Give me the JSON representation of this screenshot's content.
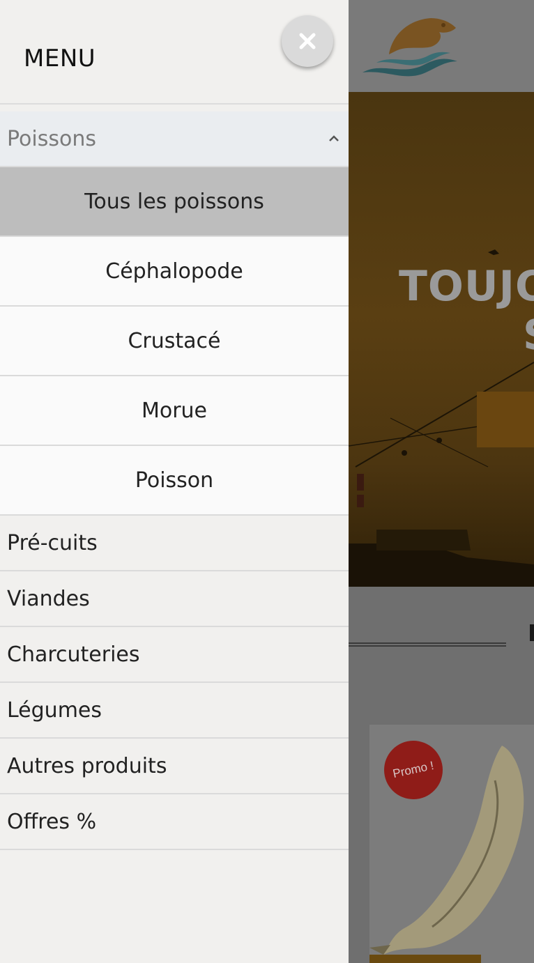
{
  "drawer": {
    "title": "MENU",
    "close_icon": "close-icon",
    "open_category": {
      "label": "Poissons",
      "chevron_icon": "chevron-up-icon",
      "items": [
        {
          "label": "Tous les poissons",
          "active": true
        },
        {
          "label": "Céphalopode",
          "active": false
        },
        {
          "label": "Crustacé",
          "active": false
        },
        {
          "label": "Morue",
          "active": false
        },
        {
          "label": "Poisson",
          "active": false
        }
      ]
    },
    "categories": [
      {
        "label": "Pré-cuits"
      },
      {
        "label": "Viandes"
      },
      {
        "label": "Charcuteries"
      },
      {
        "label": "Légumes"
      },
      {
        "label": "Autres produits"
      },
      {
        "label": "Offres %"
      }
    ]
  },
  "background": {
    "hero_title_line1": "TOUJO",
    "hero_title_line2": "S",
    "promo_badge": "Promo !"
  },
  "colors": {
    "drawer_bg": "#f1f0ee",
    "active_item_bg": "#bdbdbd",
    "open_category_bg": "#eaedf0",
    "promo_red": "#d2322d",
    "brand_orange": "#c8841e",
    "brand_teal": "#2a8a9a"
  }
}
